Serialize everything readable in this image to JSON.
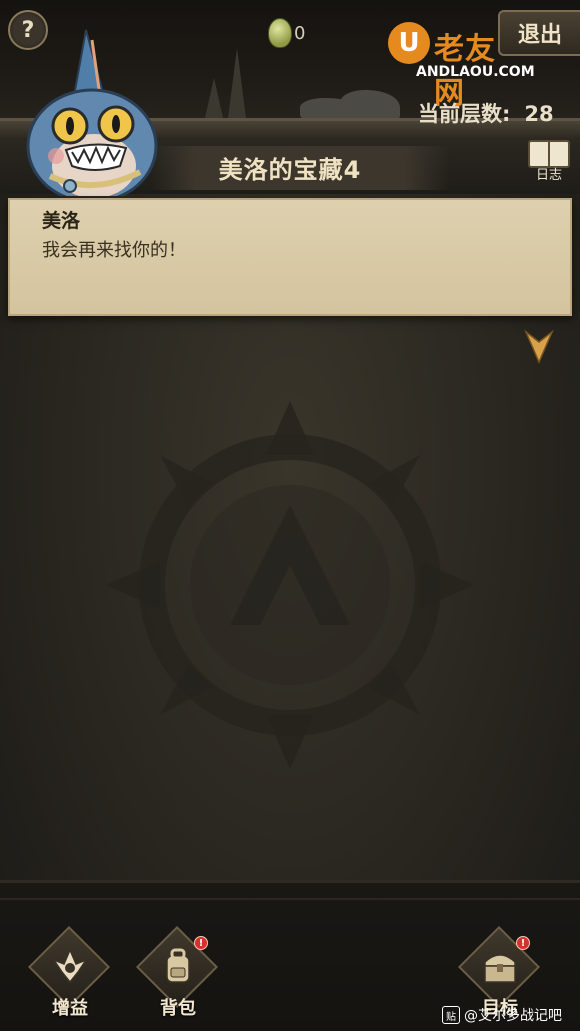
{
  "header": {
    "help_label": "?",
    "coin_count": "0",
    "exit_label": "退出",
    "floor_label": "当前层数:",
    "floor_value": "28"
  },
  "logo": {
    "mark": "U",
    "name": "老友网",
    "domain": "ANDLAOU.COM"
  },
  "banner": {
    "title": "美洛的宝藏4",
    "journal_label": "日志"
  },
  "dialog": {
    "speaker": "美洛",
    "text": "我会再来找你的！"
  },
  "bottom_nav": [
    {
      "label": "增益",
      "icon": "buff-emblem-icon",
      "badge": false
    },
    {
      "label": "背包",
      "icon": "backpack-icon",
      "badge": true
    },
    {
      "label": "目标",
      "icon": "treasure-chest-icon",
      "badge": true
    }
  ],
  "badge_text": "!",
  "watermark": {
    "icon": "贴",
    "text": "@艾尔多战记吧"
  },
  "colors": {
    "accent": "#e48a1e",
    "parchment": "#d8c9a6",
    "badge": "#d8312a"
  }
}
